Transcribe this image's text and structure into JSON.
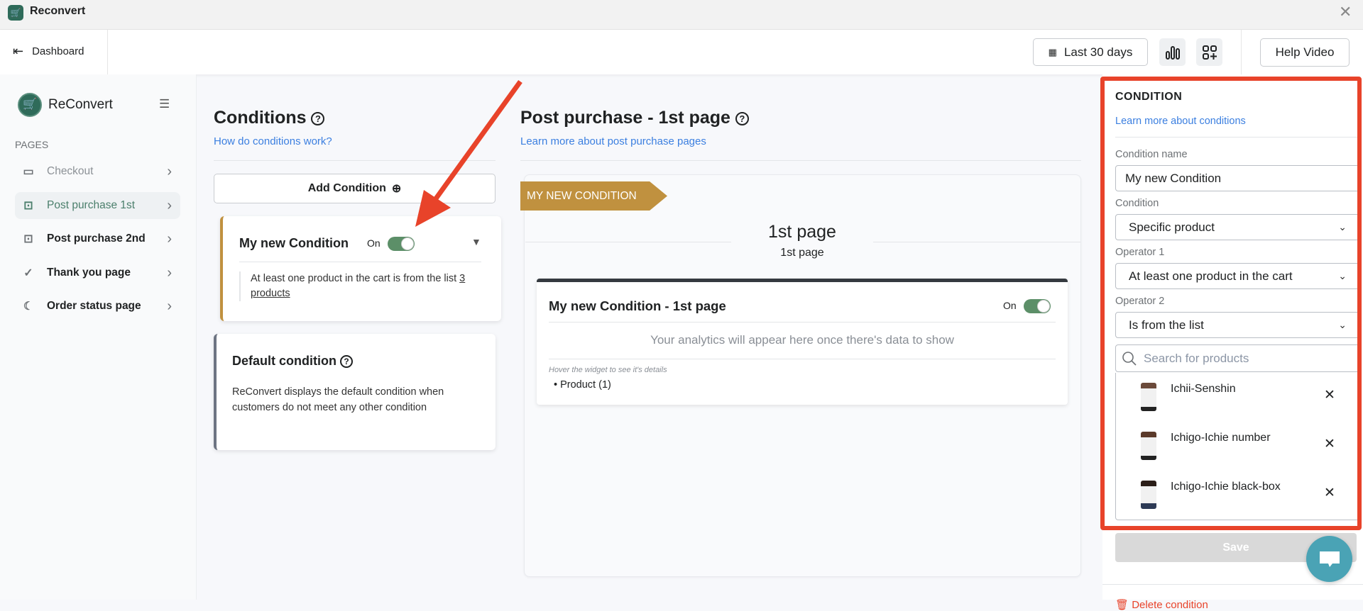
{
  "window": {
    "title": "Reconvert",
    "close_icon": "close-icon"
  },
  "header": {
    "dashboard": "Dashboard",
    "date_range": "Last 30 days",
    "help_video": "Help Video"
  },
  "sidebar": {
    "brand": "ReConvert",
    "section": "PAGES",
    "items": [
      {
        "label": "Checkout",
        "icon": "card-icon"
      },
      {
        "label": "Post purchase 1st",
        "icon": "mail-icon",
        "active": true
      },
      {
        "label": "Post purchase 2nd",
        "icon": "mail-icon"
      },
      {
        "label": "Thank you page",
        "icon": "badge-check-icon"
      },
      {
        "label": "Order status page",
        "icon": "moon-icon"
      }
    ]
  },
  "conditions": {
    "title": "Conditions",
    "link": "How do conditions work?",
    "add_button": "Add Condition",
    "custom": {
      "name": "My new Condition",
      "toggle_label": "On",
      "desc": "At least one product in the cart is from the list",
      "desc_link": "3 products"
    },
    "default": {
      "name": "Default condition",
      "desc": "ReConvert displays the default condition when customers do not meet any other condition"
    }
  },
  "post_purchase": {
    "title": "Post purchase - 1st page",
    "link": "Learn more about post purchase pages",
    "ribbon": "MY NEW CONDITION",
    "page_title": "1st page",
    "page_subtitle": "1st page",
    "widget": {
      "title": "My new Condition - 1st page",
      "toggle_label": "On",
      "empty": "Your analytics will appear here once there's data to show",
      "hint": "Hover the widget to see it's details",
      "items": [
        "Product (1)"
      ]
    }
  },
  "panel": {
    "title": "CONDITION",
    "link": "Learn more about conditions",
    "name_label": "Condition name",
    "name_value": "My new Condition",
    "condition_label": "Condition",
    "condition_value": "Specific product",
    "op1_label": "Operator 1",
    "op1_value": "At least one product in the cart",
    "op2_label": "Operator 2",
    "op2_value": "Is from the list",
    "search_placeholder": "Search for products",
    "products": [
      "Ichii-Senshin",
      "Ichigo-Ichie number",
      "Ichigo-Ichie black-box"
    ],
    "save": "Save",
    "delete": "Delete condition"
  },
  "colors": {
    "accent": "#5c8f68",
    "ribbon": "#c0913f",
    "highlight": "#e8432a",
    "link": "#3b7fe0",
    "chat": "#4aa3b5"
  }
}
